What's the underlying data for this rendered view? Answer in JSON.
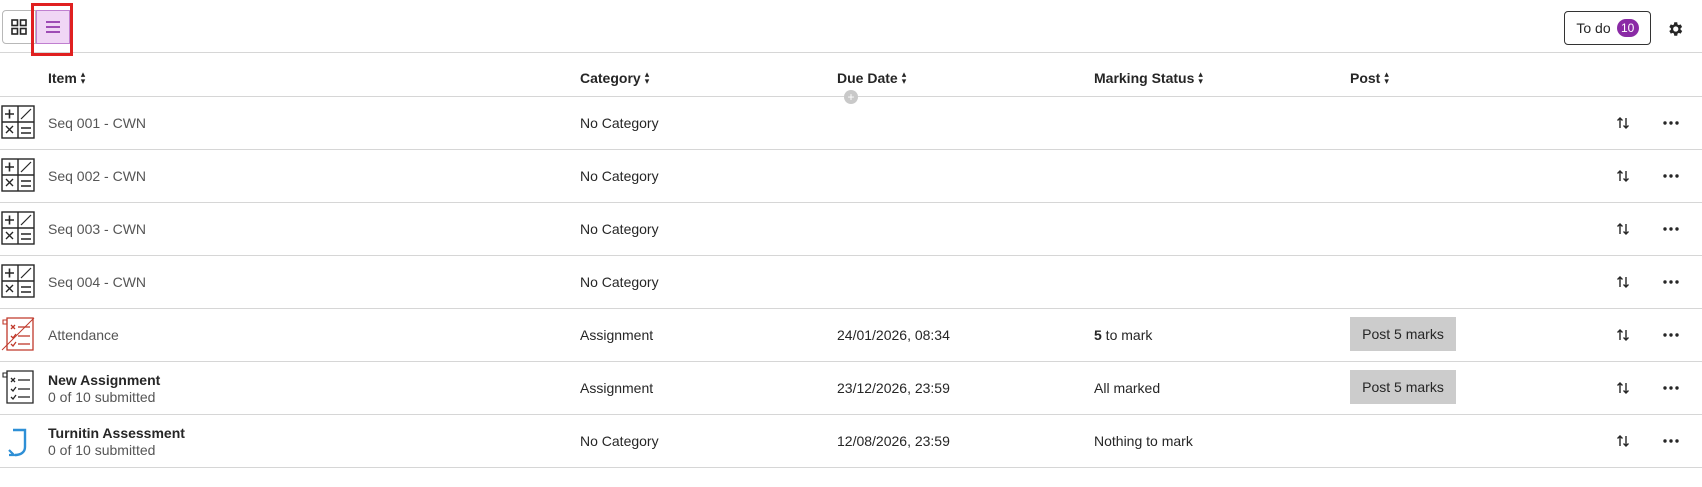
{
  "toolbar": {
    "grid_view_icon": "grid-view-icon",
    "list_view_icon": "list-view-icon",
    "todo_label": "To do",
    "todo_count": "10",
    "settings_icon": "gear-icon"
  },
  "colors": {
    "accent": "#8a2aa5",
    "list_view_active_bg": "#f0d6f5",
    "highlight": "#e02020",
    "post_button_bg": "#cccccc"
  },
  "columns": {
    "item": "Item",
    "category": "Category",
    "due_date": "Due Date",
    "marking_status": "Marking Status",
    "post": "Post"
  },
  "rows": [
    {
      "icon": "calculation-icon",
      "title": "Seq 001 - CWN",
      "subtitle": "",
      "category": "No Category",
      "due": "",
      "mark_count": "",
      "mark_text": "",
      "post_label": ""
    },
    {
      "icon": "calculation-icon",
      "title": "Seq 002 - CWN",
      "subtitle": "",
      "category": "No Category",
      "due": "",
      "mark_count": "",
      "mark_text": "",
      "post_label": ""
    },
    {
      "icon": "calculation-icon",
      "title": "Seq 003 - CWN",
      "subtitle": "",
      "category": "No Category",
      "due": "",
      "mark_count": "",
      "mark_text": "",
      "post_label": ""
    },
    {
      "icon": "calculation-icon",
      "title": "Seq 004 - CWN",
      "subtitle": "",
      "category": "No Category",
      "due": "",
      "mark_count": "",
      "mark_text": "",
      "post_label": ""
    },
    {
      "icon": "attendance-icon",
      "title": "Attendance",
      "subtitle": "",
      "category": "Assignment",
      "due": "24/01/2026, 08:34",
      "mark_count": "5",
      "mark_text": " to mark",
      "post_label": "Post 5 marks"
    },
    {
      "icon": "assignment-icon",
      "title": "New Assignment",
      "subtitle": "0 of 10 submitted",
      "category": "Assignment",
      "due": "23/12/2026, 23:59",
      "mark_count": "",
      "mark_text": "All marked",
      "post_label": "Post 5 marks"
    },
    {
      "icon": "turnitin-icon",
      "title": "Turnitin Assessment",
      "subtitle": "0 of 10 submitted",
      "category": "No Category",
      "due": "12/08/2026, 23:59",
      "mark_count": "",
      "mark_text": "Nothing to mark",
      "post_label": ""
    }
  ],
  "row_actions": {
    "reorder_icon": "reorder-arrows-icon",
    "more_icon": "more-options-icon"
  }
}
